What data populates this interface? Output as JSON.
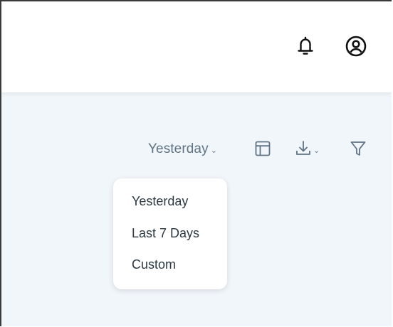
{
  "header": {
    "icons": [
      "bell-icon",
      "account-circle-icon"
    ]
  },
  "toolbar": {
    "date_range": {
      "selected": "Yesterday",
      "chevron_icon": "chevron-down-icon"
    },
    "table_icon": "table-icon",
    "download_icon": "download-icon",
    "filter_icon": "filter-icon"
  },
  "dropdown": {
    "options": [
      "Yesterday",
      "Last 7 Days",
      "Custom"
    ]
  },
  "colors": {
    "content_background": "#f1f6fb",
    "topbar_background": "#ffffff",
    "toolbar_text": "#5f7384",
    "menu_text": "#2c3942"
  }
}
